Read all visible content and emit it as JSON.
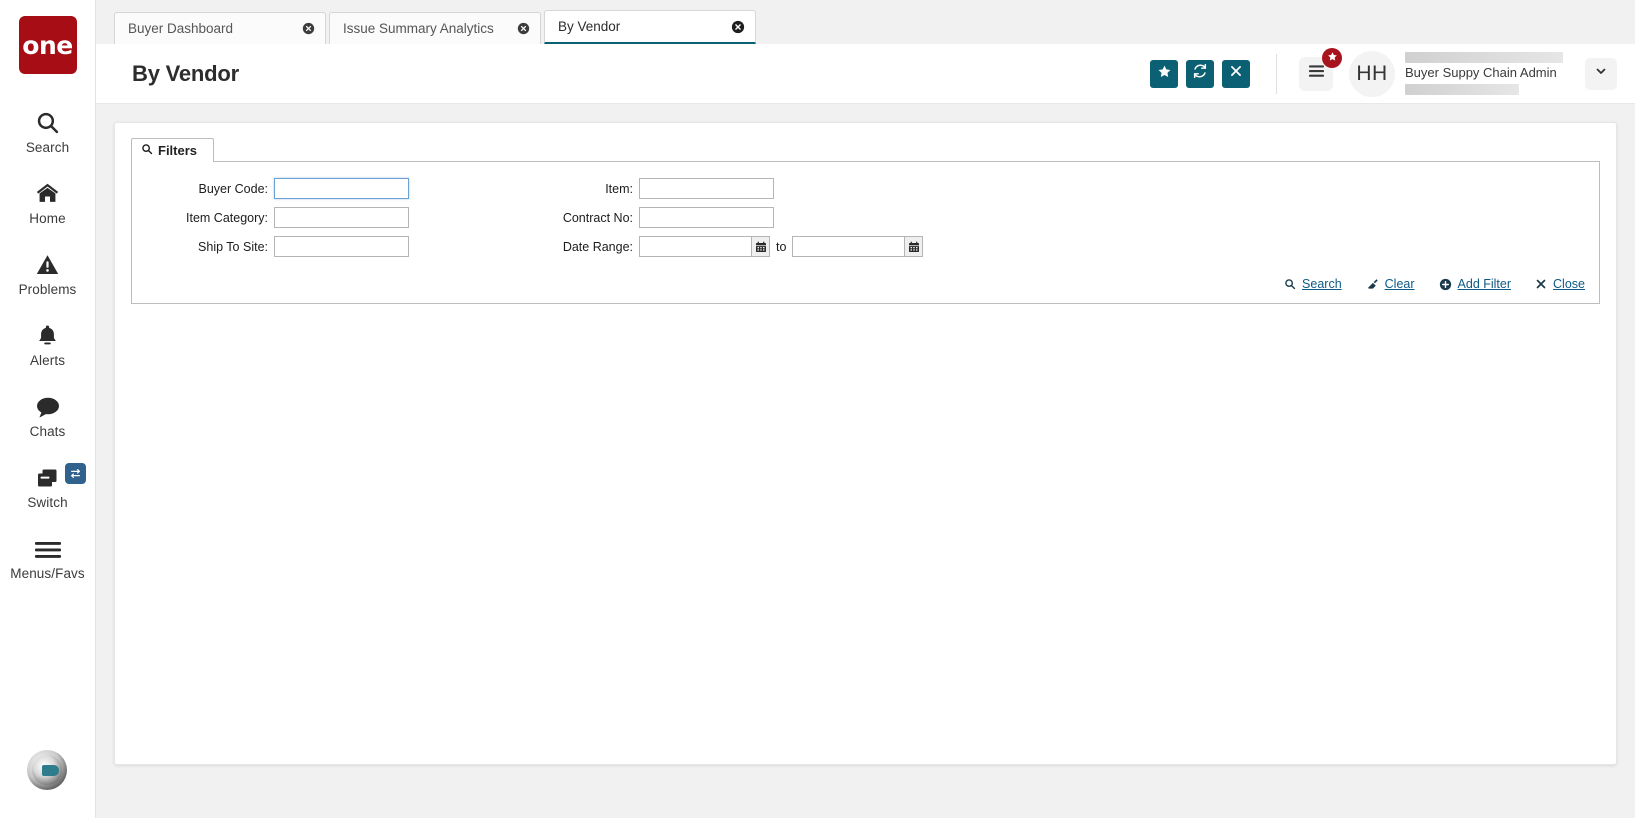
{
  "sidebar": {
    "logo_text": "one",
    "logo_color": "#a60d15",
    "items": [
      {
        "label": "Search",
        "icon": "search-icon"
      },
      {
        "label": "Home",
        "icon": "home-icon"
      },
      {
        "label": "Problems",
        "icon": "warning-triangle-icon"
      },
      {
        "label": "Alerts",
        "icon": "bell-icon"
      },
      {
        "label": "Chats",
        "icon": "chat-bubble-icon"
      },
      {
        "label": "Switch",
        "icon": "windows-stack-icon",
        "badge_icon": "exchange-arrows-icon",
        "badge_color": "#31628e"
      },
      {
        "label": "Menus/Favs",
        "icon": "hamburger-icon"
      }
    ],
    "assistant_avatar": "robot-assistant-avatar"
  },
  "tabs": [
    {
      "label": "Buyer Dashboard",
      "active": false,
      "close_icon": "close-circle-icon"
    },
    {
      "label": "Issue Summary Analytics",
      "active": false,
      "close_icon": "close-circle-icon"
    },
    {
      "label": "By Vendor",
      "active": true,
      "close_icon": "close-circle-icon"
    }
  ],
  "header": {
    "title": "By Vendor",
    "accent_color": "#0c6073",
    "actions": [
      {
        "name": "favorite-button",
        "icon": "star-icon"
      },
      {
        "name": "refresh-button",
        "icon": "refresh-icon"
      },
      {
        "name": "close-page-button",
        "icon": "x-icon"
      }
    ],
    "menu_button_icon": "hamburger-icon",
    "menu_badge_icon": "star-icon",
    "menu_badge_color": "#a8141b",
    "avatar_initials": "HH",
    "user_name": "Buyer Suppy Chain Admin",
    "dropdown_icon": "chevron-down-icon"
  },
  "filters": {
    "tab_label": "Filters",
    "tab_icon": "search-icon",
    "fields": {
      "buyer_code": {
        "label": "Buyer Code:",
        "value": "",
        "placeholder": "",
        "focused": true
      },
      "item_category": {
        "label": "Item Category:",
        "value": "",
        "placeholder": ""
      },
      "ship_to_site": {
        "label": "Ship To Site:",
        "value": "",
        "placeholder": ""
      },
      "item": {
        "label": "Item:",
        "value": "",
        "placeholder": ""
      },
      "contract_no": {
        "label": "Contract No:",
        "value": "",
        "placeholder": ""
      },
      "date_range": {
        "label": "Date Range:",
        "from_value": "",
        "to_value": "",
        "separator": "to",
        "calendar_icon": "calendar-icon"
      }
    },
    "actions": [
      {
        "name": "search-link",
        "label": "Search",
        "icon": "search-icon"
      },
      {
        "name": "clear-link",
        "label": "Clear",
        "icon": "eraser-icon"
      },
      {
        "name": "add-filter-link",
        "label": "Add Filter",
        "icon": "plus-circle-icon"
      },
      {
        "name": "close-link",
        "label": "Close",
        "icon": "x-icon"
      }
    ],
    "link_color": "#0e5a86"
  }
}
